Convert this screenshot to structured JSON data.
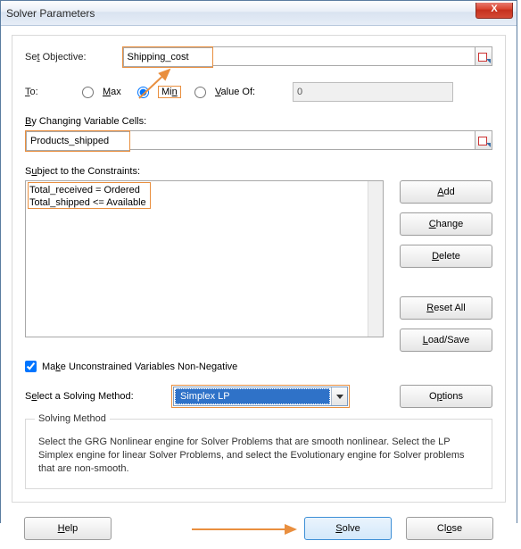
{
  "title": "Solver Parameters",
  "close": "X",
  "setObjectiveLabelPrefix": "Se",
  "setObjectiveLabelU": "t",
  "setObjectiveLabelSuffix": " Objective:",
  "objective": "Shipping_cost",
  "toLabelU": "T",
  "toLabelSuffix": "o:",
  "maxU": "M",
  "maxSuffix": "ax",
  "minPrefix": "Mi",
  "minU": "n",
  "valuePrefix": "",
  "valueU": "V",
  "valueSuffix": "alue Of:",
  "valueField": "0",
  "byLabelU": "B",
  "byLabelSuffix": "y Changing Variable Cells:",
  "variableCells": "Products_shipped",
  "subjectLabelPrefix": "S",
  "subjectLabelU": "u",
  "subjectLabelSuffix": "bject to the Constraints:",
  "constraints": [
    "Total_received = Ordered",
    "Total_shipped <= Available"
  ],
  "btnAddU": "A",
  "btnAddSuffix": "dd",
  "btnChangeU": "C",
  "btnChangeSuffix": "hange",
  "btnDeleteU": "D",
  "btnDeleteSuffix": "elete",
  "btnResetU": "R",
  "btnResetSuffix": "eset All",
  "btnLoadU": "L",
  "btnLoadSuffix": "oad/Save",
  "checkU": "K",
  "checkLabelPrefix": "Ma",
  "checkLabelSuffix": "e Unconstrained Variables Non-Negative",
  "selectLabelPrefix": "S",
  "selectLabelU": "e",
  "selectLabelSuffix": "lect a Solving Method:",
  "method": "Simplex LP",
  "btnOptionsPrefix": "O",
  "btnOptionsU": "p",
  "btnOptionsSuffix": "tions",
  "descTitle": "Solving Method",
  "descBody": "Select the GRG Nonlinear engine for Solver Problems that are smooth nonlinear. Select the LP Simplex engine for linear Solver Problems, and select the Evolutionary engine for Solver problems that are non-smooth.",
  "btnHelpU": "H",
  "btnHelpSuffix": "elp",
  "btnSolveU": "S",
  "btnSolveSuffix": "olve",
  "btnClosePrefix": "Cl",
  "btnCloseU": "o",
  "btnCloseSuffix": "se"
}
